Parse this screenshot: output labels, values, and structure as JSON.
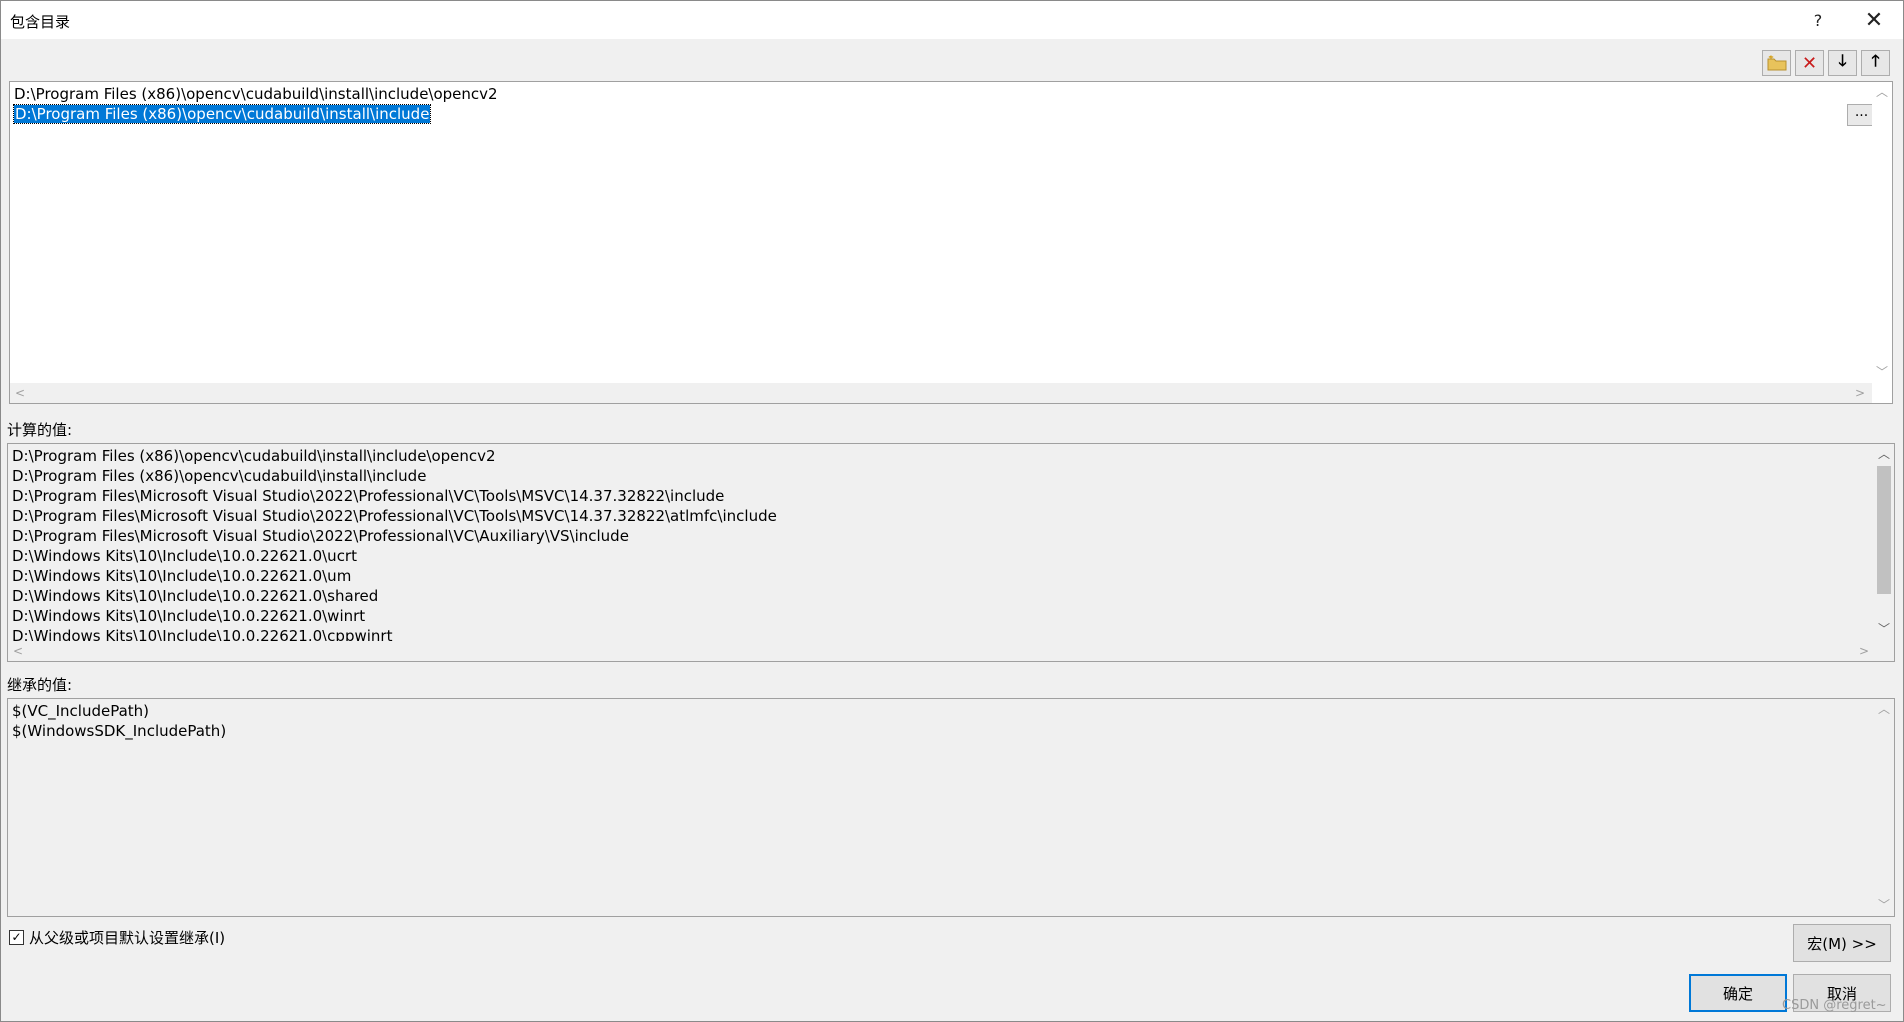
{
  "window": {
    "title": "包含目录",
    "help_glyph": "?",
    "close_glyph": "✕"
  },
  "toolbar": {
    "new_line_icon": "folder-new-icon",
    "delete_icon": "delete-x-icon",
    "move_down_icon": "arrow-down-icon",
    "move_up_icon": "arrow-up-icon",
    "delete_glyph": "✕",
    "down_glyph": "🡓",
    "up_glyph": "🡑"
  },
  "edit_list": {
    "lines": [
      "D:\\Program Files (x86)\\opencv\\cudabuild\\install\\include\\opencv2",
      "D:\\Program Files (x86)\\opencv\\cudabuild\\install\\include"
    ],
    "selected_index": 1,
    "browse_button_label": "..."
  },
  "computed": {
    "label": "计算的值:",
    "lines": [
      "D:\\Program Files (x86)\\opencv\\cudabuild\\install\\include\\opencv2",
      "D:\\Program Files (x86)\\opencv\\cudabuild\\install\\include",
      "D:\\Program Files\\Microsoft Visual Studio\\2022\\Professional\\VC\\Tools\\MSVC\\14.37.32822\\include",
      "D:\\Program Files\\Microsoft Visual Studio\\2022\\Professional\\VC\\Tools\\MSVC\\14.37.32822\\atlmfc\\include",
      "D:\\Program Files\\Microsoft Visual Studio\\2022\\Professional\\VC\\Auxiliary\\VS\\include",
      "D:\\Windows Kits\\10\\Include\\10.0.22621.0\\ucrt",
      "D:\\Windows Kits\\10\\Include\\10.0.22621.0\\um",
      "D:\\Windows Kits\\10\\Include\\10.0.22621.0\\shared",
      "D:\\Windows Kits\\10\\Include\\10.0.22621.0\\winrt",
      "D:\\Windows Kits\\10\\Include\\10.0.22621.0\\cppwinrt"
    ]
  },
  "inherited": {
    "label": "继承的值:",
    "lines": [
      "$(VC_IncludePath)",
      "$(WindowsSDK_IncludePath)"
    ]
  },
  "options": {
    "inherit_checkbox_label": "从父级或项目默认设置继承(I)",
    "inherit_checked": true,
    "check_glyph": "✓"
  },
  "buttons": {
    "macro": "宏(M) >>",
    "ok": "确定",
    "cancel": "取消"
  },
  "scroll_glyphs": {
    "up": "︿",
    "down": "﹀",
    "left": "<",
    "right": ">"
  },
  "watermark": "CSDN @regret~"
}
